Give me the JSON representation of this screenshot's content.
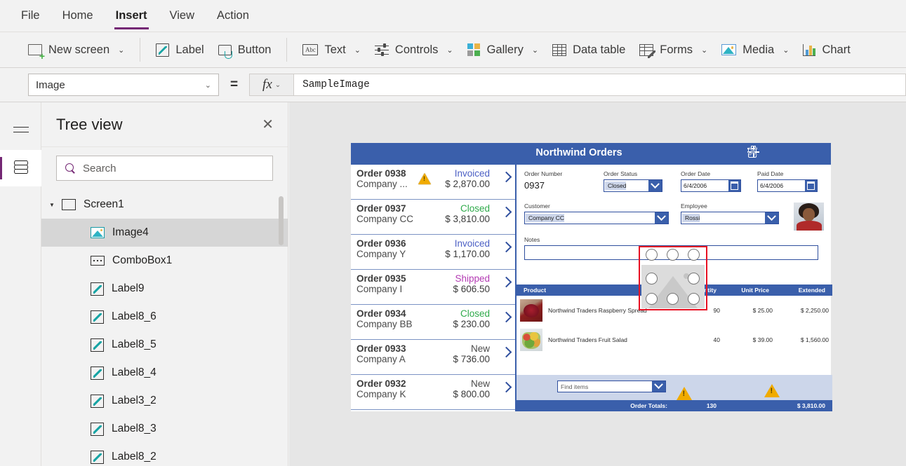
{
  "menu": {
    "items": [
      {
        "label": "File",
        "active": false
      },
      {
        "label": "Home",
        "active": false
      },
      {
        "label": "Insert",
        "active": true
      },
      {
        "label": "View",
        "active": false
      },
      {
        "label": "Action",
        "active": false
      }
    ]
  },
  "ribbon": {
    "items": [
      {
        "label": "New screen",
        "icon": "new-screen-icon",
        "chevron": "⌄"
      },
      {
        "label": "Label",
        "icon": "label-pencil-icon",
        "chevron": ""
      },
      {
        "label": "Button",
        "icon": "button-icon",
        "chevron": ""
      },
      {
        "label": "Text",
        "icon": "text-abc-icon",
        "chevron": "⌄"
      },
      {
        "label": "Controls",
        "icon": "controls-sliders-icon",
        "chevron": "⌄"
      },
      {
        "label": "Gallery",
        "icon": "gallery-icon",
        "chevron": "⌄"
      },
      {
        "label": "Data table",
        "icon": "data-table-icon",
        "chevron": ""
      },
      {
        "label": "Forms",
        "icon": "forms-icon",
        "chevron": "⌄"
      },
      {
        "label": "Media",
        "icon": "media-icon",
        "chevron": "⌄"
      },
      {
        "label": "Chart",
        "icon": "chart-icon",
        "chevron": ""
      }
    ],
    "abc_glyph": "Abc"
  },
  "formula_bar": {
    "property": "Image",
    "equals": "=",
    "fx_label": "fx",
    "chevron": "⌄",
    "formula": "SampleImage"
  },
  "tree_view": {
    "title": "Tree view",
    "close_label": "✕",
    "search_placeholder": "Search",
    "root": {
      "label": "Screen1",
      "caret": "▼",
      "icon": "screen-icon"
    },
    "items": [
      {
        "label": "Image4",
        "icon": "image-icon",
        "selected": true
      },
      {
        "label": "ComboBox1",
        "icon": "combobox-icon",
        "selected": false
      },
      {
        "label": "Label9",
        "icon": "label-icon",
        "selected": false
      },
      {
        "label": "Label8_6",
        "icon": "label-icon",
        "selected": false
      },
      {
        "label": "Label8_5",
        "icon": "label-icon",
        "selected": false
      },
      {
        "label": "Label8_4",
        "icon": "label-icon",
        "selected": false
      },
      {
        "label": "Label3_2",
        "icon": "label-icon",
        "selected": false
      },
      {
        "label": "Label8_3",
        "icon": "label-icon",
        "selected": false
      },
      {
        "label": "Label8_2",
        "icon": "label-icon",
        "selected": false
      }
    ]
  },
  "app": {
    "header": {
      "title": "Northwind Orders",
      "icons": [
        {
          "name": "delete-icon",
          "enabled": true
        },
        {
          "name": "add-icon",
          "enabled": true
        },
        {
          "name": "cancel-icon",
          "enabled": false
        },
        {
          "name": "confirm-icon",
          "enabled": false
        }
      ]
    },
    "gallery": [
      {
        "order": "Order 0938",
        "company": "Company ...",
        "status": "Invoiced",
        "amount": "$ 2,870.00",
        "status_color": "#4b5fc4",
        "warning": true
      },
      {
        "order": "Order 0937",
        "company": "Company CC",
        "status": "Closed",
        "amount": "$ 3,810.00",
        "status_color": "#2eaa4a",
        "warning": false
      },
      {
        "order": "Order 0936",
        "company": "Company Y",
        "status": "Invoiced",
        "amount": "$ 1,170.00",
        "status_color": "#4b5fc4",
        "warning": false
      },
      {
        "order": "Order 0935",
        "company": "Company I",
        "status": "Shipped",
        "amount": "$ 606.50",
        "status_color": "#b33ab3",
        "warning": false
      },
      {
        "order": "Order 0934",
        "company": "Company BB",
        "status": "Closed",
        "amount": "$ 230.00",
        "status_color": "#2eaa4a",
        "warning": false
      },
      {
        "order": "Order 0933",
        "company": "Company A",
        "status": "New",
        "amount": "$ 736.00",
        "status_color": "#4a4a4a",
        "warning": false
      },
      {
        "order": "Order 0932",
        "company": "Company K",
        "status": "New",
        "amount": "$ 800.00",
        "status_color": "#4a4a4a",
        "warning": false
      }
    ],
    "form": {
      "order_number_label": "Order Number",
      "order_number_value": "0937",
      "order_status_label": "Order Status",
      "order_status_value": "Closed",
      "order_date_label": "Order Date",
      "order_date_value": "6/4/2006",
      "paid_date_label": "Paid Date",
      "paid_date_value": "6/4/2006",
      "customer_label": "Customer",
      "customer_value": "Company CC",
      "employee_label": "Employee",
      "employee_value": "Rossi",
      "notes_label": "Notes",
      "notes_value": ""
    },
    "products": {
      "headers": [
        "Product",
        "Quantity",
        "Unit Price",
        "Extended"
      ],
      "rows": [
        {
          "name": "Northwind Traders Raspberry Spread",
          "quantity": "90",
          "unit_price": "$ 25.00",
          "extended": "$ 2,250.00",
          "thumb": "raspberry-spread-thumbnail"
        },
        {
          "name": "Northwind Traders Fruit Salad",
          "quantity": "40",
          "unit_price": "$ 39.00",
          "extended": "$ 1,560.00",
          "thumb": "fruit-salad-thumbnail"
        }
      ]
    },
    "footer": {
      "find_placeholder": "Find items",
      "totals_label": "Order Totals:",
      "totals_quantity": "130",
      "totals_amount": "$ 3,810.00"
    }
  },
  "colors": {
    "accent_purple": "#742774",
    "app_blue": "#3a5fab",
    "selection_red": "#e81123",
    "warning_amber": "#f0ab00"
  }
}
